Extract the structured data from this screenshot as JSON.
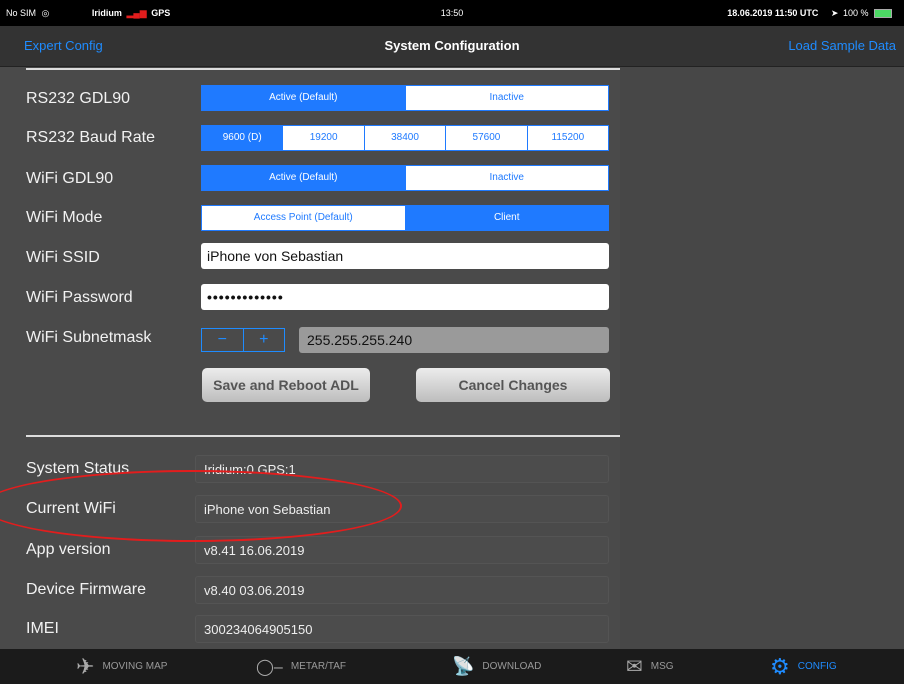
{
  "status_bar": {
    "carrier": "No SIM",
    "signal_info": "Iridium",
    "gps": "GPS",
    "time": "13:50",
    "datetime_utc": "18.06.2019 11:50 UTC",
    "battery": "100 %"
  },
  "nav": {
    "left_label": "Expert Config",
    "title": "System Configuration",
    "right_label": "Load Sample Data"
  },
  "config": {
    "rs232_gdl90": {
      "label": "RS232 GDL90",
      "options": [
        "Active (Default)",
        "Inactive"
      ],
      "selected": 0
    },
    "rs232_baud": {
      "label": "RS232 Baud Rate",
      "options": [
        "9600 (D)",
        "19200",
        "38400",
        "57600",
        "115200"
      ],
      "selected": 0
    },
    "wifi_gdl90": {
      "label": "WiFi GDL90",
      "options": [
        "Active (Default)",
        "Inactive"
      ],
      "selected": 0
    },
    "wifi_mode": {
      "label": "WiFi Mode",
      "options": [
        "Access Point (Default)",
        "Client"
      ],
      "selected": 1
    },
    "wifi_ssid": {
      "label": "WiFi SSID",
      "value": "iPhone von Sebastian"
    },
    "wifi_password": {
      "label": "WiFi Password",
      "value": "•••••••••••••"
    },
    "wifi_subnet": {
      "label": "WiFi Subnetmask",
      "minus": "−",
      "plus": "+",
      "value": "255.255.255.240"
    },
    "save_button": "Save and Reboot ADL",
    "cancel_button": "Cancel Changes"
  },
  "info": {
    "system_status": {
      "label": "System Status",
      "value": "Iridium:0 GPS:1"
    },
    "current_wifi": {
      "label": "Current WiFi",
      "value": "iPhone von Sebastian"
    },
    "app_version": {
      "label": "App version",
      "value": "v8.41 16.06.2019"
    },
    "device_firmware": {
      "label": "Device Firmware",
      "value": "v8.40 03.06.2019"
    },
    "imei": {
      "label": "IMEI",
      "value": "300234064905150"
    }
  },
  "tabs": [
    {
      "label": "MOVING MAP",
      "icon": "airplane-icon"
    },
    {
      "label": "METAR/TAF",
      "icon": "wind-icon"
    },
    {
      "label": "DOWNLOAD",
      "icon": "satellite-dish-icon"
    },
    {
      "label": "MSG",
      "icon": "envelope-icon"
    },
    {
      "label": "CONFIG",
      "icon": "gear-icon"
    }
  ],
  "colors": {
    "accent": "#1f8cff",
    "annotation": "#e21d1d",
    "background": "#4a4a4a"
  }
}
